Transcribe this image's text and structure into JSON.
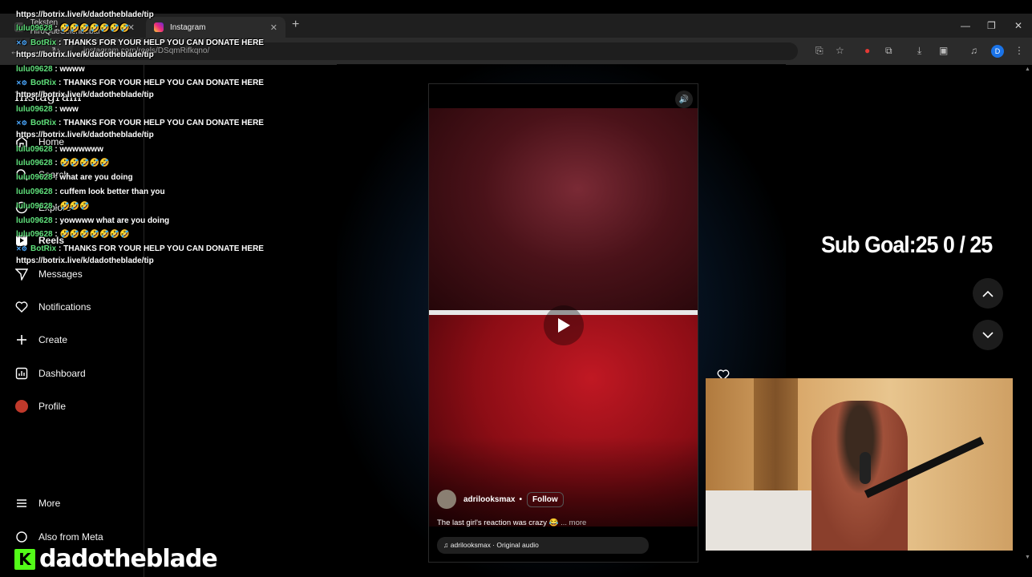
{
  "browser": {
    "tabs": [
      {
        "label": "Teksten HiroQueSelchbebar"
      },
      {
        "label": "Instagram"
      }
    ],
    "url": "instagram.com/reels/DSqmRifkqno/",
    "window_controls": {
      "minimize": "—",
      "restore": "❐",
      "close": "✕"
    },
    "profile_initial": "D"
  },
  "sidebar": {
    "brand": "Instagram",
    "items": [
      {
        "label": "Home"
      },
      {
        "label": "Search"
      },
      {
        "label": "Explore"
      },
      {
        "label": "Reels"
      },
      {
        "label": "Messages"
      },
      {
        "label": "Notifications"
      },
      {
        "label": "Create"
      },
      {
        "label": "Dashboard"
      },
      {
        "label": "Profile"
      },
      {
        "label": "More"
      },
      {
        "label": "Also from Meta"
      }
    ]
  },
  "reel": {
    "author": "adrilooksmax",
    "separator": "•",
    "follow_label": "Follow",
    "caption": "The last girl's reaction was crazy 😂",
    "more_label": "... more",
    "audio": "adrilooksmax · Original audio"
  },
  "overlay": {
    "sub_goal": "Sub Goal:25   0 / 25",
    "streamer": "dadotheblade",
    "kick_letter": "K"
  },
  "chat": {
    "messages": [
      {
        "type": "url",
        "text": "https://botrix.live/k/dadotheblade/tip"
      },
      {
        "type": "user",
        "user": "lulu09628",
        "text": "🤣🤣🤣🤣🤣🤣🤣"
      },
      {
        "type": "bot",
        "user": "BotRix",
        "text": "THANKS FOR YOUR HELP YOU CAN DONATE HERE"
      },
      {
        "type": "url",
        "text": "https://botrix.live/k/dadotheblade/tip"
      },
      {
        "type": "user",
        "user": "lulu09628",
        "text": "wwww"
      },
      {
        "type": "bot",
        "user": "BotRix",
        "text": "THANKS FOR YOUR HELP YOU CAN DONATE HERE"
      },
      {
        "type": "url",
        "text": "https://botrix.live/k/dadotheblade/tip"
      },
      {
        "type": "user",
        "user": "lulu09628",
        "text": "www"
      },
      {
        "type": "bot",
        "user": "BotRix",
        "text": "THANKS FOR YOUR HELP YOU CAN DONATE HERE"
      },
      {
        "type": "url",
        "text": "https://botrix.live/k/dadotheblade/tip"
      },
      {
        "type": "user",
        "user": "lulu09628",
        "text": "wwwwwww"
      },
      {
        "type": "user",
        "user": "lulu09628",
        "text": "🤣🤣🤣🤣🤣"
      },
      {
        "type": "user",
        "user": "lulu09628",
        "text": "what are you doing"
      },
      {
        "type": "user",
        "user": "lulu09628",
        "text": "cuffem look better than you"
      },
      {
        "type": "user",
        "user": "lulu09628",
        "text": "🤣🤣🤣"
      },
      {
        "type": "user",
        "user": "lulu09628",
        "text": "yowwww what are you doing"
      },
      {
        "type": "user",
        "user": "lulu09628",
        "text": "🤣🤣🤣🤣🤣🤣🤣"
      },
      {
        "type": "bot",
        "user": "BotRix",
        "text": "THANKS FOR YOUR HELP YOU CAN DONATE HERE"
      },
      {
        "type": "url",
        "text": "https://botrix.live/k/dadotheblade/tip"
      }
    ]
  },
  "colors": {
    "chat_user": "#5fe07b",
    "kick_green": "#53fc18",
    "reel_red": "#c01823"
  }
}
